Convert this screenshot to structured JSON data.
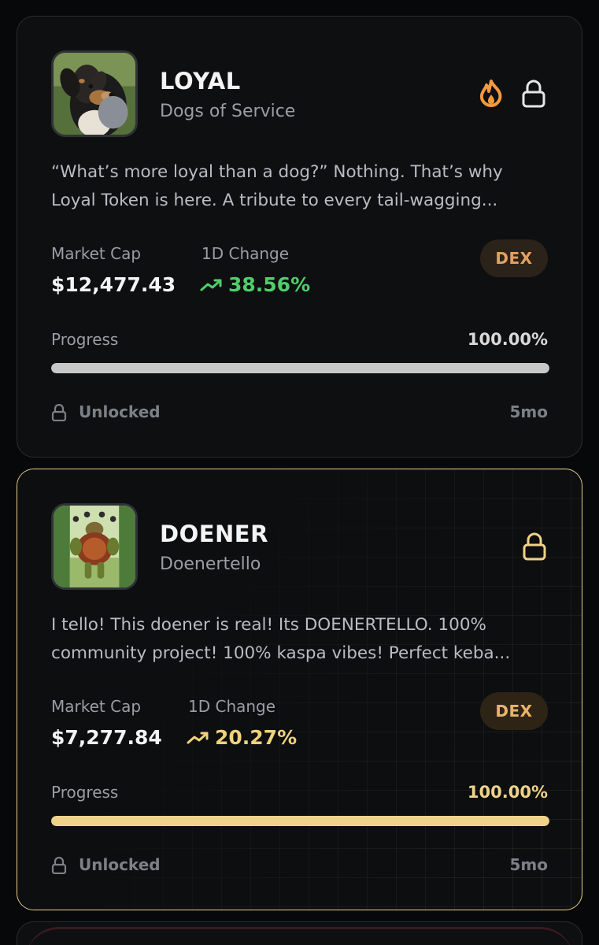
{
  "tokens": [
    {
      "symbol": "LOYAL",
      "name": "Dogs of Service",
      "avatar": "dog-avatar",
      "description_lines": [
        "“What’s more loyal than a dog?” Nothing. That’s why",
        "Loyal Token is here. A tribute to every tail-wagging..."
      ],
      "market_cap_label": "Market Cap",
      "market_cap": "$12,477.43",
      "change_label": "1D Change",
      "change": "38.56%",
      "change_color": "#4fce6a",
      "badge": "DEX",
      "progress_label": "Progress",
      "progress_text": "100.00%",
      "progress": 1.0,
      "progress_color": "#c8c8c8",
      "status": "Unlocked",
      "age": "5mo",
      "icons": [
        "fire-icon",
        "lock-icon"
      ]
    },
    {
      "symbol": "DOENER",
      "name": "Doenertello",
      "avatar": "turtle-avatar",
      "description_lines": [
        "I tello! This doener is real! Its DOENERTELLO. 100%",
        "community project! 100% kaspa vibes! Perfect keba..."
      ],
      "market_cap_label": "Market Cap",
      "market_cap": "$7,277.84",
      "change_label": "1D Change",
      "change": "20.27%",
      "change_color": "#f0d27c",
      "badge": "DEX",
      "progress_label": "Progress",
      "progress_text": "100.00%",
      "progress": 1.0,
      "progress_color": "#efd38a",
      "status": "Unlocked",
      "age": "5mo",
      "icons": [
        "lock-icon"
      ]
    }
  ],
  "colors": {
    "accent_gold": "#e9cf8a",
    "fire_orange": "#f19a3e",
    "card_bg": "#0e0f11"
  }
}
